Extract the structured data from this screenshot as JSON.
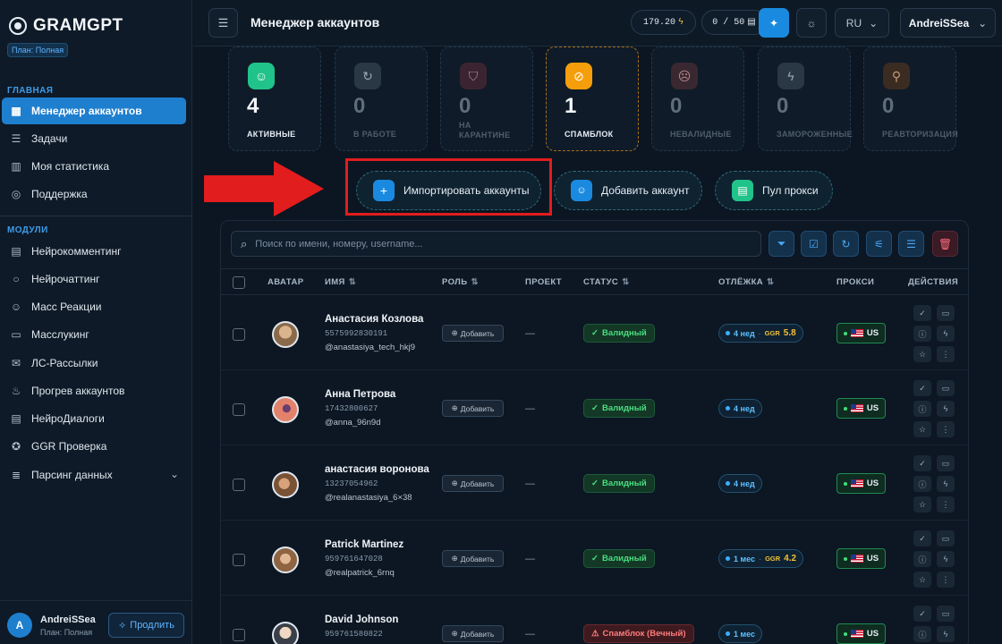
{
  "brand": {
    "name": "GRAMGPT",
    "plan": "План: Полная"
  },
  "sidebar": {
    "main_title": "ГЛАВНАЯ",
    "main_items": [
      {
        "label": "Менеджер аккаунтов",
        "icon": "dashboard-icon",
        "active": true
      },
      {
        "label": "Задачи",
        "icon": "list-icon"
      },
      {
        "label": "Моя статистика",
        "icon": "chart-icon"
      },
      {
        "label": "Поддержка",
        "icon": "support-icon"
      }
    ],
    "modules_title": "МОДУЛИ",
    "module_items": [
      {
        "label": "Нейрокомментинг",
        "icon": "comment-icon"
      },
      {
        "label": "Нейрочаттинг",
        "icon": "chat-icon"
      },
      {
        "label": "Масс Реакции",
        "icon": "smile-icon"
      },
      {
        "label": "Масслукинг",
        "icon": "monitor-icon"
      },
      {
        "label": "ЛС-Рассылки",
        "icon": "message-icon"
      },
      {
        "label": "Прогрев аккаунтов",
        "icon": "flame-icon"
      },
      {
        "label": "НейроДиалоги",
        "icon": "dialog-icon"
      },
      {
        "label": "GGR Проверка",
        "icon": "star-icon"
      },
      {
        "label": "Парсинг данных",
        "icon": "database-icon"
      }
    ],
    "user": {
      "initial": "A",
      "name": "AndreiSSea",
      "plan": "План: Полная",
      "extend": "Продлить"
    }
  },
  "header": {
    "title": "Менеджер аккаунтов",
    "balance": "179.20",
    "counter": "0 / 50",
    "language": "RU",
    "user": "AndreiSSea"
  },
  "stats": [
    {
      "value": "4",
      "label": "АКТИВНЫЕ",
      "icon": "user-icon",
      "color": "#20c38a"
    },
    {
      "value": "0",
      "label": "В РАБОТЕ",
      "icon": "refresh-icon",
      "color": "#6b7785"
    },
    {
      "value": "0",
      "label": "НА КАРАНТИНЕ",
      "icon": "shield-icon",
      "color": "#b05a69"
    },
    {
      "value": "1",
      "label": "СПАМБЛОК",
      "icon": "ban-icon",
      "color": "#f59e0b"
    },
    {
      "value": "0",
      "label": "НЕВАЛИДНЫЕ",
      "icon": "user-x-icon",
      "color": "#a0666d"
    },
    {
      "value": "0",
      "label": "ЗАМОРОЖЕННЫЕ",
      "icon": "bolt-icon",
      "color": "#6b7785"
    },
    {
      "value": "0",
      "label": "РЕАВТОРИЗАЦИЯ",
      "icon": "key-icon",
      "color": "#9c7052"
    }
  ],
  "actions": {
    "import": "Импортировать аккаунты",
    "add": "Добавить аккаунт",
    "proxy_pool": "Пул прокси"
  },
  "search": {
    "placeholder": "Поиск по имени, номеру, username..."
  },
  "table": {
    "columns": [
      "АВАТАР",
      "ИМЯ",
      "РОЛЬ",
      "ПРОЕКТ",
      "СТАТУС",
      "ОТЛЁЖКА",
      "ПРОКСИ",
      "ДЕЙСТВИЯ"
    ],
    "add_label": "Добавить",
    "rows": [
      {
        "name": "Анастасия Козлова",
        "phone": "5575992830191",
        "username": "@anastasiya_tech_hkj9",
        "project": "—",
        "status": "Валидный",
        "status_type": "valid",
        "rest": "4 нед",
        "ggr": "GGR",
        "ggr_value": "5.8",
        "proxy": "US",
        "avatar_color": "#c9a27a"
      },
      {
        "name": "Анна Петрова",
        "phone": "17432800627",
        "username": "@anna_96n9d",
        "project": "—",
        "status": "Валидный",
        "status_type": "valid",
        "rest": "4 нед",
        "proxy": "US",
        "avatar_color": "#e3826a"
      },
      {
        "name": "анастасия воронова",
        "phone": "13237054962",
        "username": "@realanastasiya_6×38",
        "project": "—",
        "status": "Валидный",
        "status_type": "valid",
        "rest": "4 нед",
        "proxy": "US",
        "avatar_color": "#c58b62"
      },
      {
        "name": "Patrick Martinez",
        "phone": "959761647028",
        "username": "@realpatrick_6rnq",
        "project": "—",
        "status": "Валидный",
        "status_type": "valid",
        "rest": "1 мес",
        "ggr": "GGR",
        "ggr_value": "4.2",
        "proxy": "US",
        "avatar_color": "#a67d57"
      },
      {
        "name": "David Johnson",
        "phone": "959761580822",
        "username": "",
        "project": "—",
        "status": "Спамблок (Вечный)",
        "status_type": "spam",
        "rest": "1 мес",
        "proxy": "US",
        "avatar_color": "#b9a99a"
      }
    ]
  }
}
